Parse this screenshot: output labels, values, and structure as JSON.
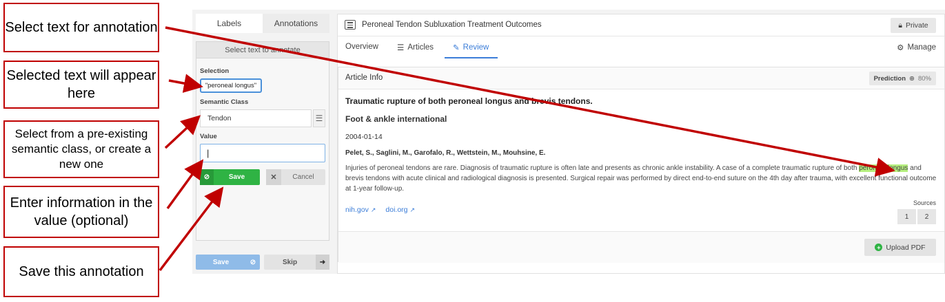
{
  "callouts": {
    "select_text": "Select text for annotation",
    "selected_text": "Selected text will appear here",
    "semantic_class": "Select from a pre-existing semantic class, or create a new one",
    "enter_value": "Enter information in the value (optional)",
    "save": "Save this annotation"
  },
  "left_panel": {
    "tabs": [
      "Labels",
      "Annotations"
    ],
    "header": "Select text to annotate",
    "selection_label": "Selection",
    "selection_value": "\"peroneal longus\"",
    "semantic_class_label": "Semantic Class",
    "semantic_class_value": "Tendon",
    "value_label": "Value",
    "value_input": "|",
    "save_label": "Save",
    "cancel_label": "Cancel",
    "bottom_save_label": "Save",
    "skip_label": "Skip"
  },
  "header": {
    "project_title": "Peroneal Tendon Subluxation Treatment Outcomes",
    "private_label": "Private"
  },
  "nav": {
    "overview": "Overview",
    "articles": "Articles",
    "review": "Review",
    "manage": "Manage"
  },
  "article": {
    "card_title": "Article Info",
    "prediction_label": "Prediction",
    "prediction_value": "80%",
    "title": "Traumatic rupture of both peroneal longus and brevis tendons.",
    "journal": "Foot & ankle international",
    "date": "2004-01-14",
    "authors": "Pelet, S., Saglini, M., Garofalo, R., Wettstein, M., Mouhsine, E.",
    "abstract_before": "Injuries of peroneal tendons are rare. Diagnosis of traumatic rupture is often late and presents as chronic ankle instability. A case of a complete traumatic rupture of both ",
    "abstract_highlight": "peroneal longus",
    "abstract_after": " and brevis tendons with acute clinical and radiological diagnosis is presented. Surgical repair was performed by direct end-to-end suture on the 4th day after trauma, with excellent functional outcome at 1-year follow-up.",
    "links": [
      "nih.gov",
      "doi.org"
    ],
    "sources_label": "Sources",
    "sources": [
      "1",
      "2"
    ],
    "upload_label": "Upload PDF"
  },
  "colors": {
    "callout_border": "#c00000",
    "accent": "#3b7dd8",
    "save_green": "#2fb344",
    "highlight": "#b6f07f"
  }
}
